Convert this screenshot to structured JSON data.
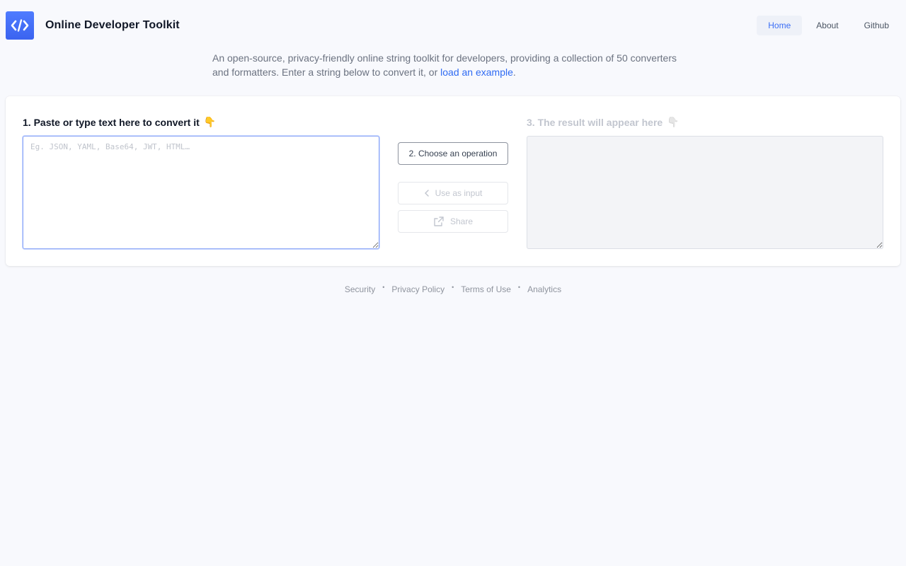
{
  "app": {
    "title": "Online Developer Toolkit",
    "logo_icon": "code-brackets-icon",
    "accent_color": "#3b6ef5"
  },
  "nav": {
    "items": [
      {
        "label": "Home",
        "active": true
      },
      {
        "label": "About",
        "active": false
      },
      {
        "label": "Github",
        "active": false
      }
    ]
  },
  "intro": {
    "text_before_link": "An open-source, privacy-friendly online string toolkit for developers, providing a collection of 50 converters and formatters. Enter a string below to convert it, or ",
    "link_text": "load an example",
    "text_after_link": "."
  },
  "input_panel": {
    "label": "1. Paste or type text here to convert it",
    "emoji": "👇",
    "placeholder": "Eg. JSON, YAML, Base64, JWT, HTML…",
    "value": ""
  },
  "actions": {
    "choose_operation": "2. Choose an operation",
    "use_as_input": "Use as input",
    "use_as_input_icon": "chevron-left-icon",
    "share": "Share",
    "share_icon": "external-link-icon"
  },
  "result_panel": {
    "label": "3. The result will appear here",
    "emoji": "👇",
    "value": ""
  },
  "footer": {
    "links": [
      "Security",
      "Privacy Policy",
      "Terms of Use",
      "Analytics"
    ]
  }
}
